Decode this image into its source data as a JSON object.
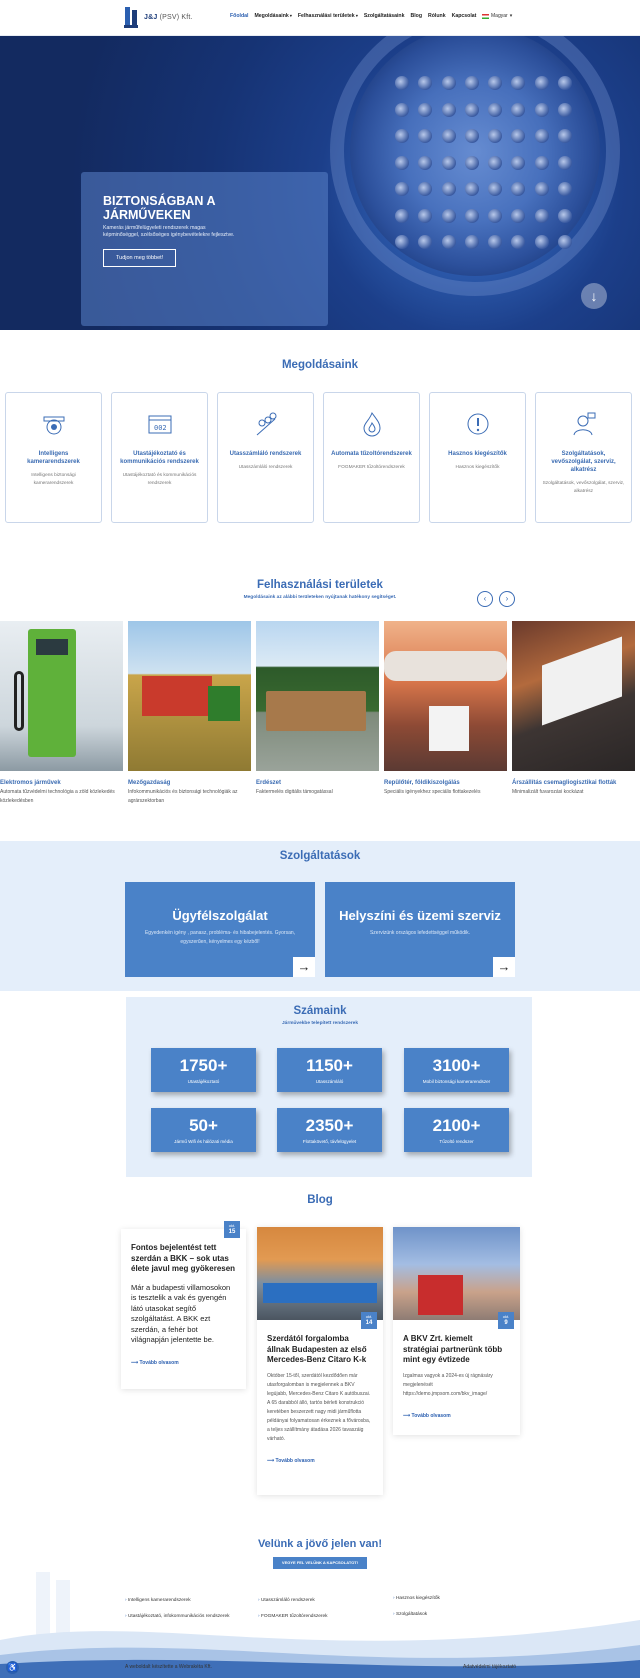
{
  "header": {
    "logo_text": "J&J",
    "logo_sub": "(PSV) Kft.",
    "nav": [
      {
        "label": "Főoldal"
      },
      {
        "label": "Megoldásaink"
      },
      {
        "label": "Felhasználási területek"
      },
      {
        "label": "Szolgáltatásaink"
      },
      {
        "label": "Blog"
      },
      {
        "label": "Rólunk"
      },
      {
        "label": "Kapcsolat"
      }
    ],
    "language": "Magyar"
  },
  "hero": {
    "title": "BIZTONSÁGBAN A JÁRMŰVEKEN",
    "subtitle": "Kamerás járműfelügyeleti rendszerek magas képminőséggel, szélsőséges igénybevételekre fejlesztve.",
    "button": "Tudjon meg többet!",
    "scroll_icon": "arrow-down-icon"
  },
  "solutions": {
    "title": "Megoldásaink",
    "items": [
      {
        "name": "Intelligens kamerarendszerek",
        "desc": "Intelligens biztonsági kamerarendszerek",
        "icon": "camera-icon"
      },
      {
        "name": "Utastájékoztató és kommunikációs rendszerek",
        "desc": "Utastájékoztató és kommunikációs rendszerek",
        "icon": "display-board-icon"
      },
      {
        "name": "Utasszámláló rendszerek",
        "desc": "Utasszámláló rendszerek",
        "icon": "people-count-icon"
      },
      {
        "name": "Automata tűzoltórendszerek",
        "desc": "FOGMAKER tűzoltórendszerek",
        "icon": "flame-icon"
      },
      {
        "name": "Hasznos kiegészítők",
        "desc": "Hasznos kiegészítők",
        "icon": "exclamation-icon"
      },
      {
        "name": "Szolgáltatások, vevőszolgálat, szerviz, alkatrész",
        "desc": "Szolgáltatások, vevőszolgálat, szerviz, alkatrész",
        "icon": "support-agent-icon"
      }
    ]
  },
  "areas": {
    "title": "Felhasználási területek",
    "subtitle": "Megoldásaink az alábbi területeken nyújtanak hatékony segítséget.",
    "items": [
      {
        "name": "Elektromos járművek",
        "desc": "Automata tűzvédelmi technológia a zöld közlekedés közlekedésben"
      },
      {
        "name": "Mezőgazdaság",
        "desc": "Infokommunikációs és biztonsági technológiák az agrárszektorban"
      },
      {
        "name": "Erdészet",
        "desc": "Faktermelés digitális támogatással"
      },
      {
        "name": "Repülőtér, földikiszolgálás",
        "desc": "Speciális igényekhez speciális flottakezelés"
      },
      {
        "name": "Árszállítás csemagliogisztikai flották",
        "desc": "Minimalizált fuvarozási kockázat"
      }
    ]
  },
  "services": {
    "title": "Szolgáltatások",
    "items": [
      {
        "name": "Ügyfélszolgálat",
        "desc": "Egyedenkén igény , panasz, probléma- és hibabejelentés. Gyorsan, egyszerűen, kényelmes egy kézből!"
      },
      {
        "name": "Helyszíni és üzemi szerviz",
        "desc": "Szervizünk országos lefedettséggel működik."
      }
    ]
  },
  "stats": {
    "title": "Számaink",
    "subtitle": "Járművekbe telepített rendszerek",
    "items": [
      {
        "value": "1750+",
        "label": "Utastájékoztató"
      },
      {
        "value": "1150+",
        "label": "Utasszámláló"
      },
      {
        "value": "3100+",
        "label": "Mobil biztonsági kamerarendszer"
      },
      {
        "value": "50+",
        "label": "Jármű Wifi és hálózati média"
      },
      {
        "value": "2350+",
        "label": "Flottakövető, távfelügyelet"
      },
      {
        "value": "2100+",
        "label": "Tűzoltó rendszer"
      }
    ]
  },
  "blog": {
    "title": "Blog",
    "posts": [
      {
        "month": "okt.",
        "day": "15",
        "title": "Fontos bejelentést tett szerdán a BKK – sok utas élete javul meg gyökeresen",
        "body": "Már a budapesti villamosokon is tesztelik a vak és gyengén látó utasokat segítő szolgáltatást. A BKK ezt szerdán, a fehér bot világnapján jelentette be.",
        "more": "⟶ Tovább olvasom"
      },
      {
        "month": "okt.",
        "day": "14",
        "title": "Szerdától forgalomba állnak Budapesten az első Mercedes-Benz Citaro K-k",
        "body": "Október 15-től, szerdától kezdődően már utasforgalomban is megjelennek a BKV legújabb, Mercedes-Benz Citaro K autóbuszai. A 65 darabból álló, tartós bérleti konstrukció keretében beszerzett nagy midi járműflotta példányai folyamatosan érkeznek a fővárosba, a teljes szállítmány átadása 2026 tavaszáig várható.",
        "more": "⟶ Tovább olvasom"
      },
      {
        "month": "okt.",
        "day": "9",
        "title": "A BKV Zrt. kiemelt stratégiai partnerünk több mint egy évtizede",
        "body": "Izgalmas vagyok a 2024-es új rágnásáry megjelenését https://demo.jmpsom.com/bkv_image/",
        "more": "⟶ Tovább olvasom"
      }
    ]
  },
  "cta": {
    "title": "Velünk a jövő jelen van!",
    "button": "VEGYE FEL VELÜNK A KAPCSOLATOT!"
  },
  "footer": {
    "col1": [
      "Intelligens kamerarendszerek",
      "Utastájékoztató, infokommunikációs rendszerek"
    ],
    "col2": [
      "Utasszámláló rendszerek",
      "FOGMAKER tűzoltórendszerek"
    ],
    "col3": [
      "Hasznos kiegészítők",
      "Szolgáltatások"
    ],
    "copyright": "A weboldalt készítette a Webrakéta Kft.",
    "privacy": "Adatvédelmi tájékoztató"
  },
  "colors": {
    "accent": "#3b6cb5",
    "card_blue": "#4a82c8",
    "light_bg": "#e4eefa"
  }
}
